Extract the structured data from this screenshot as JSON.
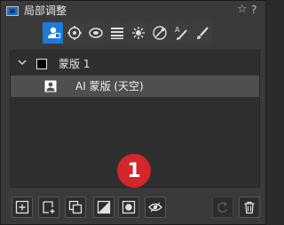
{
  "panel": {
    "title": "局部调整",
    "star_glyph": "☆",
    "help_glyph": "?"
  },
  "tool_tabs": [
    {
      "name": "mask-tool-tab",
      "icon": "person-mask-icon",
      "active": true
    },
    {
      "name": "draw-mask-tab",
      "icon": "target-brush-icon",
      "active": false
    },
    {
      "name": "radial-mask-tab",
      "icon": "radial-icon",
      "active": false
    },
    {
      "name": "linear-mask-tab",
      "icon": "linear-gradient-icon",
      "active": false
    },
    {
      "name": "magic-brush-tab",
      "icon": "magic-wand-icon",
      "active": false
    },
    {
      "name": "color-range-tab",
      "icon": "color-range-icon",
      "active": false
    },
    {
      "name": "text-brush-tab",
      "icon": "text-brush-icon",
      "active": false
    },
    {
      "name": "brush-tab",
      "icon": "brush-icon",
      "active": false
    }
  ],
  "layers": {
    "mask_name": "蒙版 1",
    "ai_mask_name": "AI 蒙版 (天空)"
  },
  "badge_number": "1",
  "bottom_toolbar": [
    {
      "name": "add-mask-button",
      "icon": "plus-square-icon"
    },
    {
      "name": "add-layer-button",
      "icon": "plus-layer-icon"
    },
    {
      "name": "duplicate-button",
      "icon": "duplicate-icon"
    },
    {
      "name": "invert-button",
      "icon": "invert-icon"
    },
    {
      "name": "fill-mask-button",
      "icon": "fill-mask-icon"
    },
    {
      "name": "show-mask-button",
      "icon": "eye-icon"
    },
    {
      "name": "reset-button",
      "icon": "reset-icon",
      "disabled": true
    },
    {
      "name": "delete-button",
      "icon": "trash-icon"
    }
  ],
  "colors": {
    "accent": "#1e7ad6",
    "badge": "#d4262b",
    "selected_row": "#4f4f4f"
  }
}
